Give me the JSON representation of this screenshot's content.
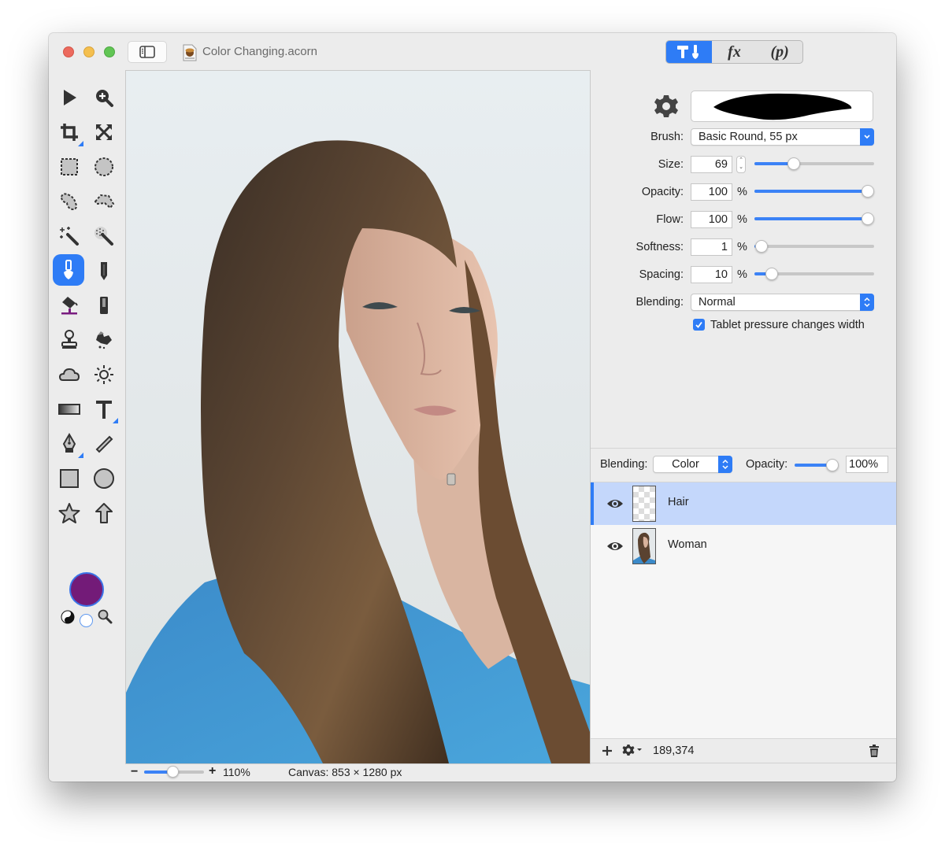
{
  "window": {
    "title": "Color Changing.acorn",
    "mode_tabs": [
      {
        "name": "tools",
        "label": "",
        "active": true
      },
      {
        "name": "fx",
        "label": "fx",
        "active": false
      },
      {
        "name": "properties",
        "label": "(p)",
        "active": false
      }
    ]
  },
  "toolbar": {
    "tools": [
      {
        "name": "select-arrow",
        "active": false
      },
      {
        "name": "zoom",
        "active": false
      },
      {
        "name": "crop",
        "active": false,
        "has_submenu": true
      },
      {
        "name": "transform",
        "active": false
      },
      {
        "name": "rect-marquee",
        "active": false
      },
      {
        "name": "oval-marquee",
        "active": false
      },
      {
        "name": "lasso",
        "active": false
      },
      {
        "name": "polygon-lasso",
        "active": false
      },
      {
        "name": "magic-wand",
        "active": false
      },
      {
        "name": "instant-alpha",
        "active": false
      },
      {
        "name": "brush",
        "active": true
      },
      {
        "name": "pencil",
        "active": false
      },
      {
        "name": "paint-bucket",
        "active": false
      },
      {
        "name": "eraser",
        "active": false
      },
      {
        "name": "clone-stamp",
        "active": false
      },
      {
        "name": "smudge",
        "active": false
      },
      {
        "name": "burn",
        "active": false
      },
      {
        "name": "dodge",
        "active": false
      },
      {
        "name": "gradient",
        "active": false
      },
      {
        "name": "text",
        "active": false,
        "has_submenu": true
      },
      {
        "name": "bezier-pen",
        "active": false,
        "has_submenu": true
      },
      {
        "name": "line",
        "active": false
      },
      {
        "name": "rectangle-shape",
        "active": false
      },
      {
        "name": "oval-shape",
        "active": false
      },
      {
        "name": "star-shape",
        "active": false
      },
      {
        "name": "arrow-shape",
        "active": false
      }
    ],
    "foreground_color": "#731b78",
    "background_color": "#ffffff"
  },
  "canvas": {
    "description": "Photo of a woman with long brown hair wearing a blue shirt",
    "zoom_label": "110%",
    "zoom_fraction": 0.47,
    "size_label": "Canvas: 853 × 1280 px"
  },
  "inspector": {
    "brush_label": "Brush:",
    "brush_value": "Basic Round, 55 px",
    "size_label": "Size:",
    "size_value": "69",
    "size_fraction": 0.31,
    "opacity_label": "Opacity:",
    "opacity_value": "100",
    "opacity_fraction": 1.0,
    "flow_label": "Flow:",
    "flow_value": "100",
    "flow_fraction": 1.0,
    "softness_label": "Softness:",
    "softness_value": "1",
    "softness_fraction": 0.01,
    "spacing_label": "Spacing:",
    "spacing_value": "10",
    "spacing_fraction": 0.1,
    "blending_label": "Blending:",
    "blending_value": "Normal",
    "percent_unit": "%",
    "tablet_pressure_label": "Tablet pressure changes width",
    "tablet_pressure_checked": true
  },
  "layers": {
    "blending_label": "Blending:",
    "blending_value": "Color",
    "opacity_label": "Opacity:",
    "opacity_value": "100%",
    "opacity_fraction": 1.0,
    "items": [
      {
        "name": "Hair",
        "visible": true,
        "selected": true,
        "thumbnail": "transparent"
      },
      {
        "name": "Woman",
        "visible": true,
        "selected": false,
        "thumbnail": "photo"
      }
    ],
    "cursor_coords": "189,374"
  }
}
